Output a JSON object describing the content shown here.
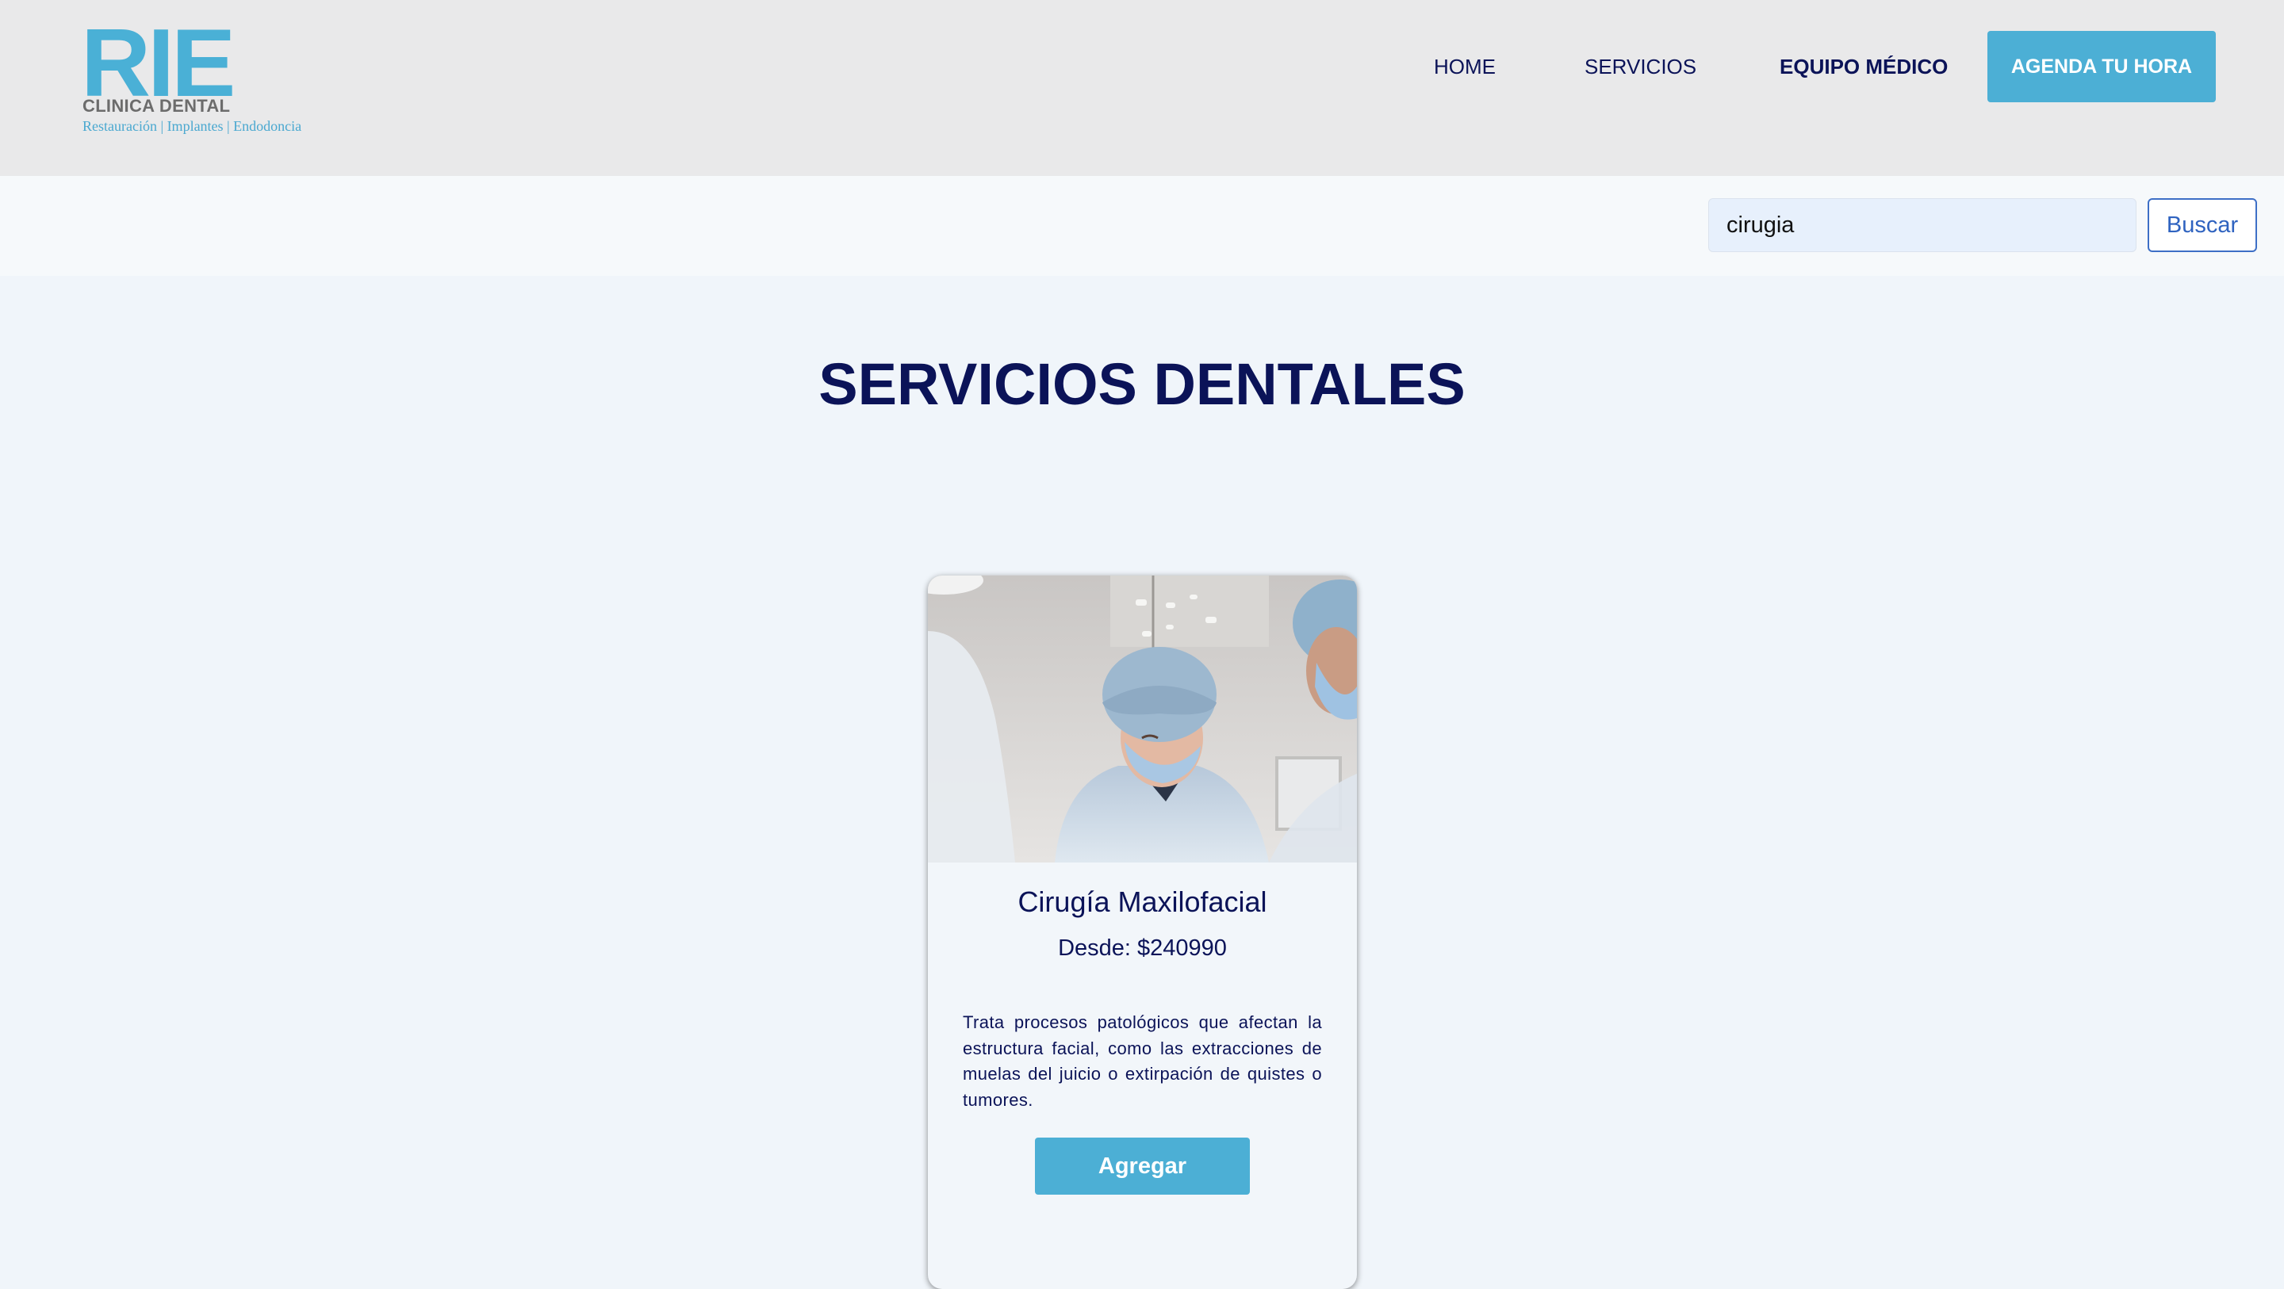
{
  "header": {
    "logo": {
      "mark": "RIE",
      "subtitle": "CLINICA DENTAL",
      "tagline": "Restauración | Implantes | Endodoncia"
    },
    "nav": {
      "home": "HOME",
      "servicios": "SERVICIOS",
      "equipo": "EQUIPO MÉDICO"
    },
    "cta_label": "AGENDA TU HORA"
  },
  "search": {
    "value": "cirugia",
    "button_label": "Buscar"
  },
  "main": {
    "title": "SERVICIOS DENTALES",
    "services": [
      {
        "title": "Cirugía Maxilofacial",
        "price": "Desde: $240990",
        "description": "Trata procesos patológicos que afectan la estructura facial, como las extracciones de muelas del juicio o extirpación de quistes o tumores.",
        "button_label": "Agregar",
        "image_icon": "surgeon-photo"
      }
    ]
  },
  "colors": {
    "accent": "#4cafd5",
    "navy": "#0b1358",
    "header_bg": "#e9e9ea",
    "page_bg": "#f0f5fa"
  }
}
